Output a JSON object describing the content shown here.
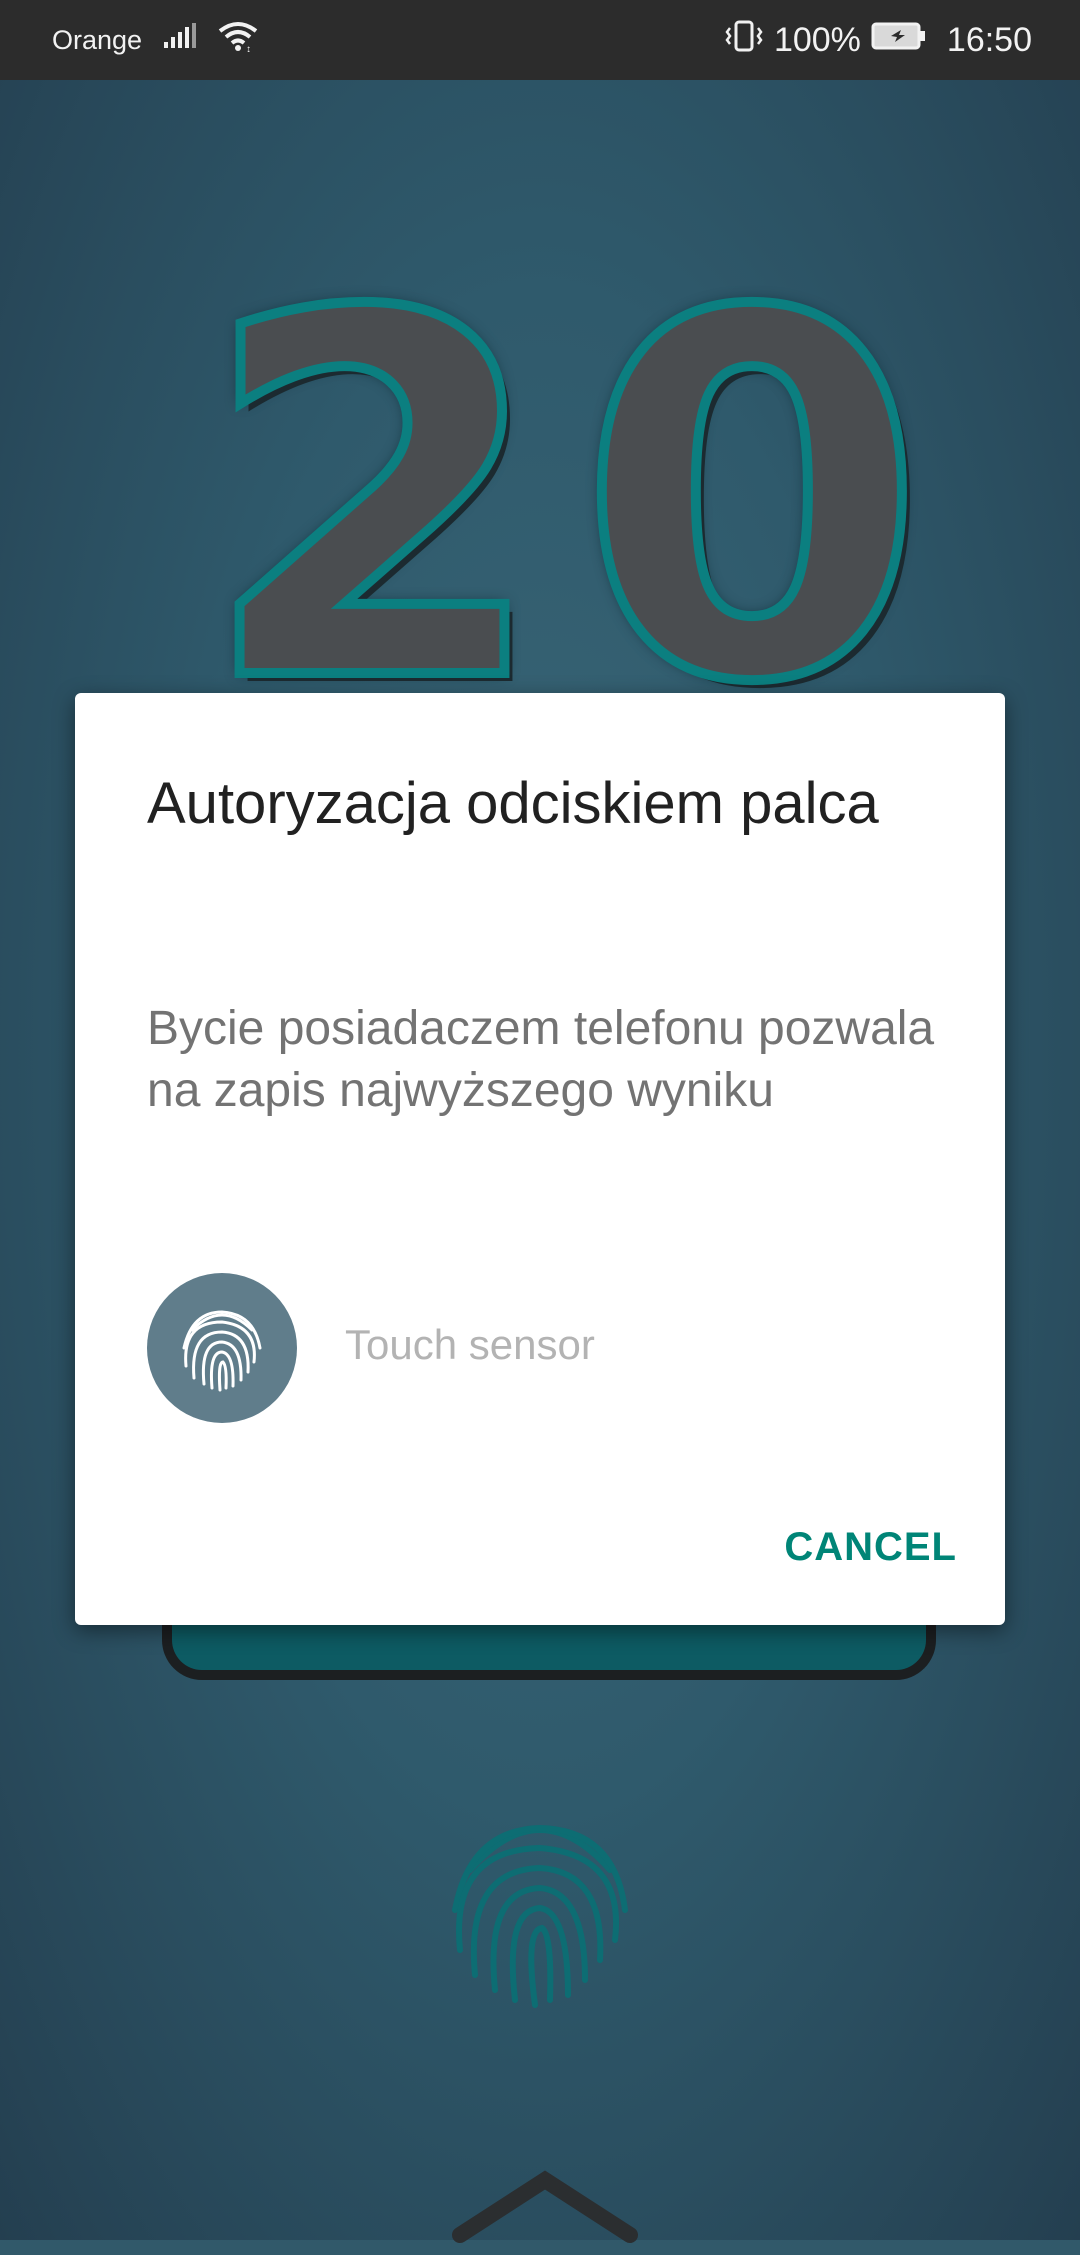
{
  "status_bar": {
    "carrier": "Orange",
    "battery": "100%",
    "time": "16:50",
    "icons": [
      "signal-icon",
      "wifi-icon",
      "vibrate-icon",
      "battery-charging-icon"
    ]
  },
  "background": {
    "big_number": "20",
    "icons": [
      "fingerprint-icon",
      "chevron-up-icon"
    ]
  },
  "dialog": {
    "title": "Autoryzacja odciskiem palca",
    "message": "Bycie posiadaczem telefonu pozwala na zapis najwyższego wyniku",
    "sensor_status": "Touch sensor",
    "cancel_label": "CANCEL",
    "icon": "fingerprint-icon"
  },
  "colors": {
    "accent": "#008577",
    "fingerprint_circle": "#607d8b",
    "background": "#31596a",
    "status_bar": "#2c2c2c"
  }
}
